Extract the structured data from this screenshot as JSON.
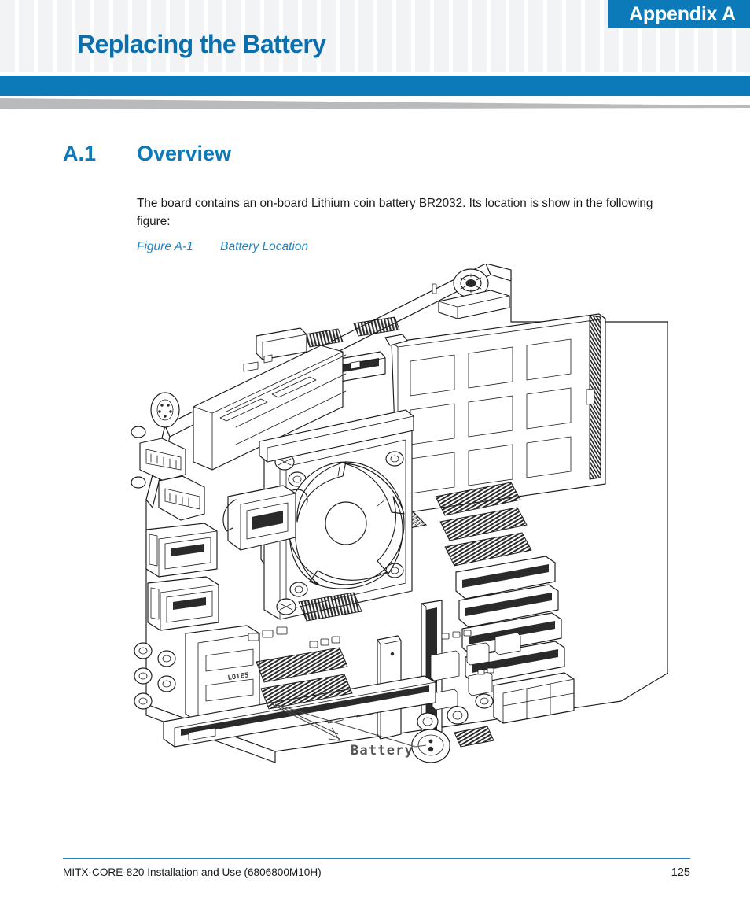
{
  "header": {
    "appendix_badge": "Appendix A",
    "chapter_title": "Replacing the Battery",
    "accent_blue": "#0c79b8",
    "title_blue": "#0c6fad",
    "grid_square_color": "#f2f3f4",
    "taper_gray": "#b8babc"
  },
  "section": {
    "number": "A.1",
    "name": "Overview",
    "paragraph": "The board contains an on-board Lithium coin battery BR2032. Its location is show in the following figure:"
  },
  "figure": {
    "label": "Figure A-1",
    "title": "Battery Location",
    "caption_color": "#1f84c4",
    "callout_label": "Battery",
    "callout_color": "#545454",
    "alt": "Isometric line drawing of a Mini-ITX motherboard showing the location of the BR2032 lithium coin battery"
  },
  "footer": {
    "document": "MITX-CORE-820 Installation and Use (6806800M10H)",
    "page_number": "125",
    "rule_color": "#1f84c4"
  }
}
